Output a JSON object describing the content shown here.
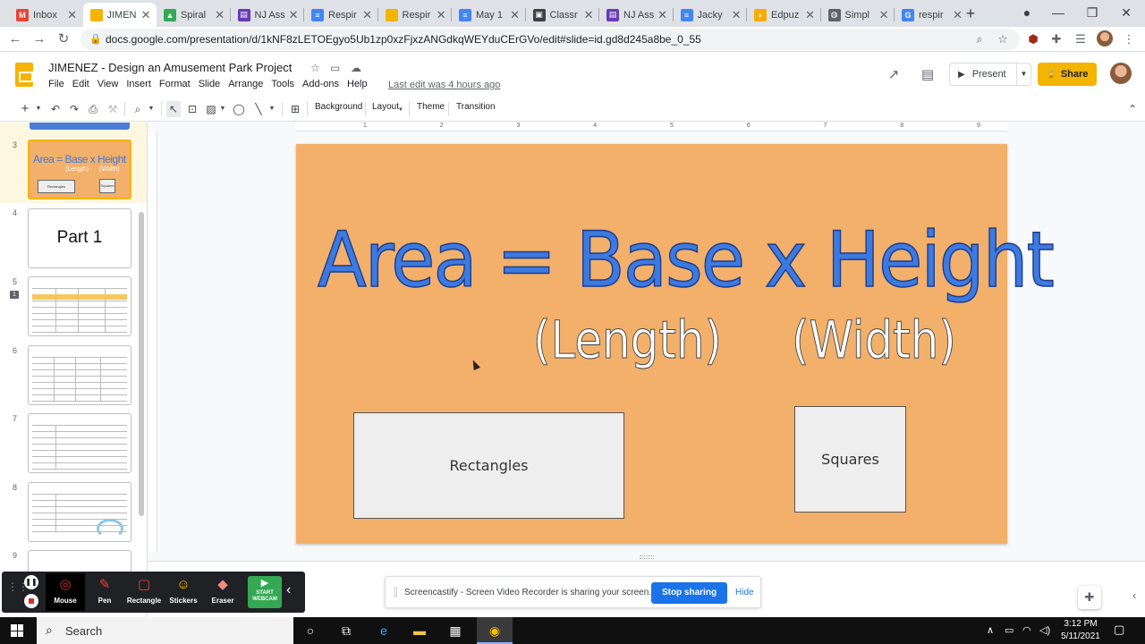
{
  "browser": {
    "tabs": [
      {
        "label": "Inbox",
        "color": "#ea4335",
        "glyph": "M"
      },
      {
        "label": "JIMEN",
        "color": "#f4b400",
        "glyph": "",
        "active": true
      },
      {
        "label": "Spiral",
        "color": "#34a853",
        "glyph": "▲"
      },
      {
        "label": "NJ Ass",
        "color": "#673ab7",
        "glyph": "▤"
      },
      {
        "label": "Respir",
        "color": "#4285f4",
        "glyph": "≡"
      },
      {
        "label": "Respir",
        "color": "#f4b400",
        "glyph": ""
      },
      {
        "label": "May 1",
        "color": "#4285f4",
        "glyph": "≡"
      },
      {
        "label": "Classr",
        "color": "#3c4043",
        "glyph": "▣"
      },
      {
        "label": "NJ Ass",
        "color": "#673ab7",
        "glyph": "▤"
      },
      {
        "label": "Jacky",
        "color": "#4285f4",
        "glyph": "≡"
      },
      {
        "label": "Edpuz",
        "color": "#f9ab00",
        "glyph": "◗"
      },
      {
        "label": "Simpl",
        "color": "#5f6368",
        "glyph": "◍"
      },
      {
        "label": "respir",
        "color": "#4285f4",
        "glyph": "G"
      }
    ],
    "url": "docs.google.com/presentation/d/1kNF8zLETOEgyo5Ub1zp0xzFjxzANGdkqWEYduCErGVo/edit#slide=id.gd8d245a8be_0_55"
  },
  "doc": {
    "title": "JIMENEZ - Design an Amusement Park Project",
    "menu": [
      "File",
      "Edit",
      "View",
      "Insert",
      "Format",
      "Slide",
      "Arrange",
      "Tools",
      "Add-ons",
      "Help"
    ],
    "last_edit": "Last edit was 4 hours ago",
    "present_label": "Present",
    "share_label": "Share"
  },
  "toolbar": {
    "background": "Background",
    "layout": "Layout",
    "theme": "Theme",
    "transition": "Transition"
  },
  "filmstrip": {
    "slides": [
      {
        "num": "3",
        "title": "Area = Base x Height",
        "sub1": "(Length)",
        "sub2": "(Width)",
        "box1": "Rectangles",
        "box2": "Squares"
      },
      {
        "num": "4",
        "title": "Part 1"
      },
      {
        "num": "5"
      },
      {
        "num": "6"
      },
      {
        "num": "7"
      },
      {
        "num": "8"
      },
      {
        "num": "9"
      }
    ],
    "comment_count": "1"
  },
  "ruler": {
    "ticks": [
      "1",
      "2",
      "3",
      "4",
      "5",
      "6",
      "7",
      "8",
      "9"
    ]
  },
  "slide": {
    "title": "Area = Base x Height",
    "sub1": "(Length)",
    "sub2": "(Width)",
    "box1": "Rectangles",
    "box2": "Squares",
    "bg_color": "#f2b06a",
    "title_color": "#3d7ae0"
  },
  "screencastify": {
    "tools": [
      "Mouse",
      "Pen",
      "Rectangle",
      "Stickers",
      "Eraser"
    ],
    "webcam_line1": "START",
    "webcam_line2": "WEBCAM",
    "banner_msg": "Screencastify - Screen Video Recorder is sharing your screen.",
    "stop_label": "Stop sharing",
    "hide_label": "Hide"
  },
  "taskbar": {
    "search_label": "Search",
    "time": "3:12 PM",
    "date": "5/11/2021"
  }
}
